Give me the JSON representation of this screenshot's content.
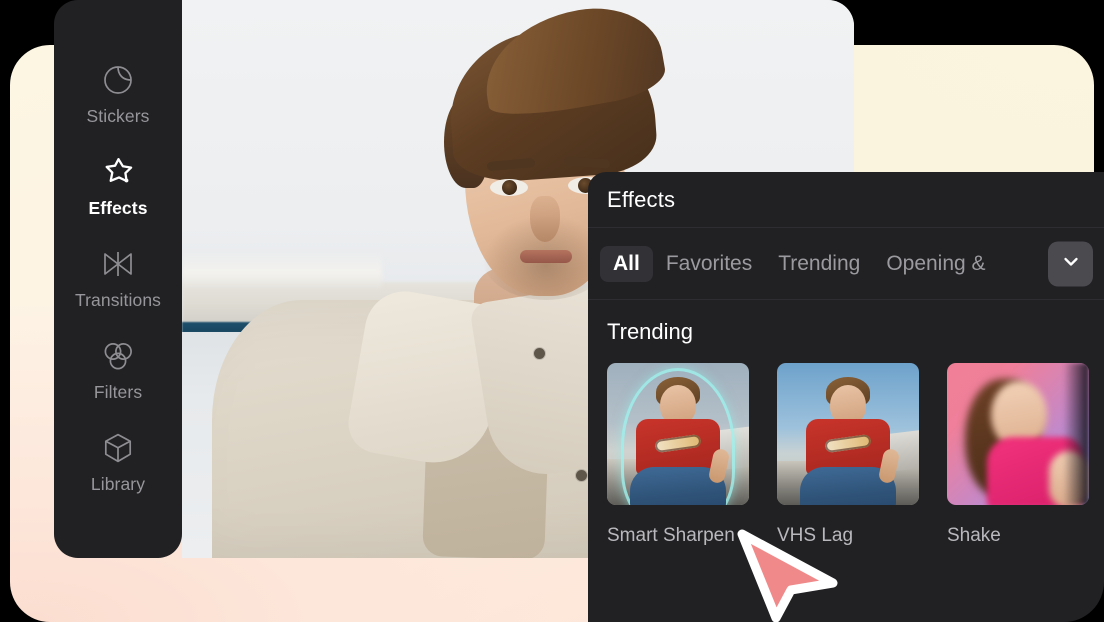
{
  "sidebar": {
    "items": [
      {
        "label": "Stickers",
        "icon": "sticker-icon",
        "active": false
      },
      {
        "label": "Effects",
        "icon": "star-sparkle-icon",
        "active": true
      },
      {
        "label": "Transitions",
        "icon": "transition-icon",
        "active": false
      },
      {
        "label": "Filters",
        "icon": "filters-icon",
        "active": false
      },
      {
        "label": "Library",
        "icon": "cube-icon",
        "active": false
      }
    ]
  },
  "panel": {
    "title": "Effects",
    "tabs": [
      {
        "label": "All",
        "active": true
      },
      {
        "label": "Favorites",
        "active": false
      },
      {
        "label": "Trending",
        "active": false
      },
      {
        "label": "Opening &",
        "active": false
      }
    ],
    "dropdown_icon": "chevron-down-icon",
    "section_title": "Trending",
    "effects": [
      {
        "label": "Smart Sharpen"
      },
      {
        "label": "VHS Lag"
      },
      {
        "label": "Shake"
      }
    ]
  },
  "cursor": {
    "icon": "pointer-arrow-cursor"
  },
  "colors": {
    "panel_bg": "#212124",
    "accent_cursor": "#f08a8a",
    "active_tab_bg": "#323236",
    "dropdown_bg": "#4a4a4f",
    "text_primary": "#ffffff",
    "text_muted": "#9b9b9f",
    "card_cream": "#fdf6e2",
    "card_peach": "#fde3d4"
  }
}
